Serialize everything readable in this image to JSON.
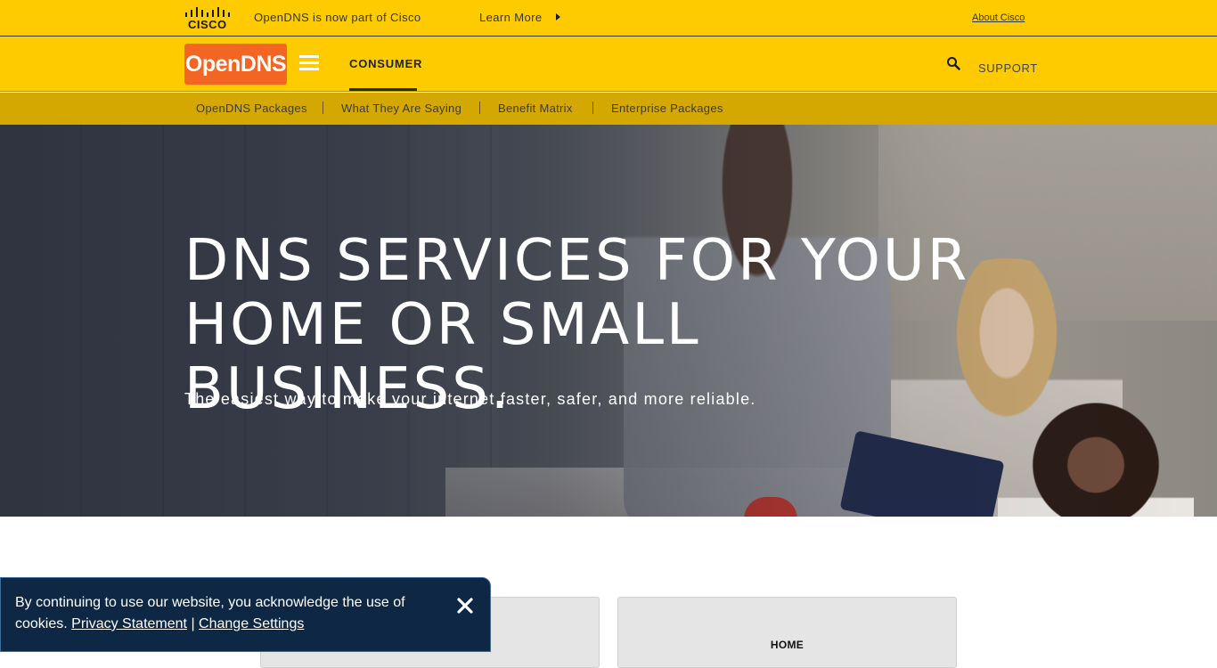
{
  "cisco_bar": {
    "logo_word": "CISCO",
    "message": "OpenDNS is now part of Cisco",
    "learn_more": "Learn More",
    "about_link": "About Cisco"
  },
  "main_nav": {
    "logo_text": "OpenDNS",
    "consumer_label": "CONSUMER",
    "support_label": "SUPPORT"
  },
  "sub_nav": {
    "items": [
      {
        "label": "OpenDNS Packages"
      },
      {
        "label": "What They Are Saying"
      },
      {
        "label": "Benefit Matrix"
      },
      {
        "label": "Enterprise Packages"
      }
    ]
  },
  "hero": {
    "title_line_1": "DNS SERVICES FOR YOUR",
    "title_line_2": "HOME OR SMALL BUSINESS.",
    "subtitle": "The easiest way to make your internet faster, safer, and more reliable."
  },
  "cards": {
    "home_label": "HOME"
  },
  "cookie_banner": {
    "text": "By continuing to use our website, you acknowledge the use of cookies.",
    "privacy_link": "Privacy Statement",
    "separator": "|",
    "settings_link": "Change Settings"
  },
  "colors": {
    "brand_yellow": "#fecb00",
    "subnav_yellow": "#d4a800",
    "logo_orange": "#f26522",
    "cookie_navy": "#0d2745"
  }
}
